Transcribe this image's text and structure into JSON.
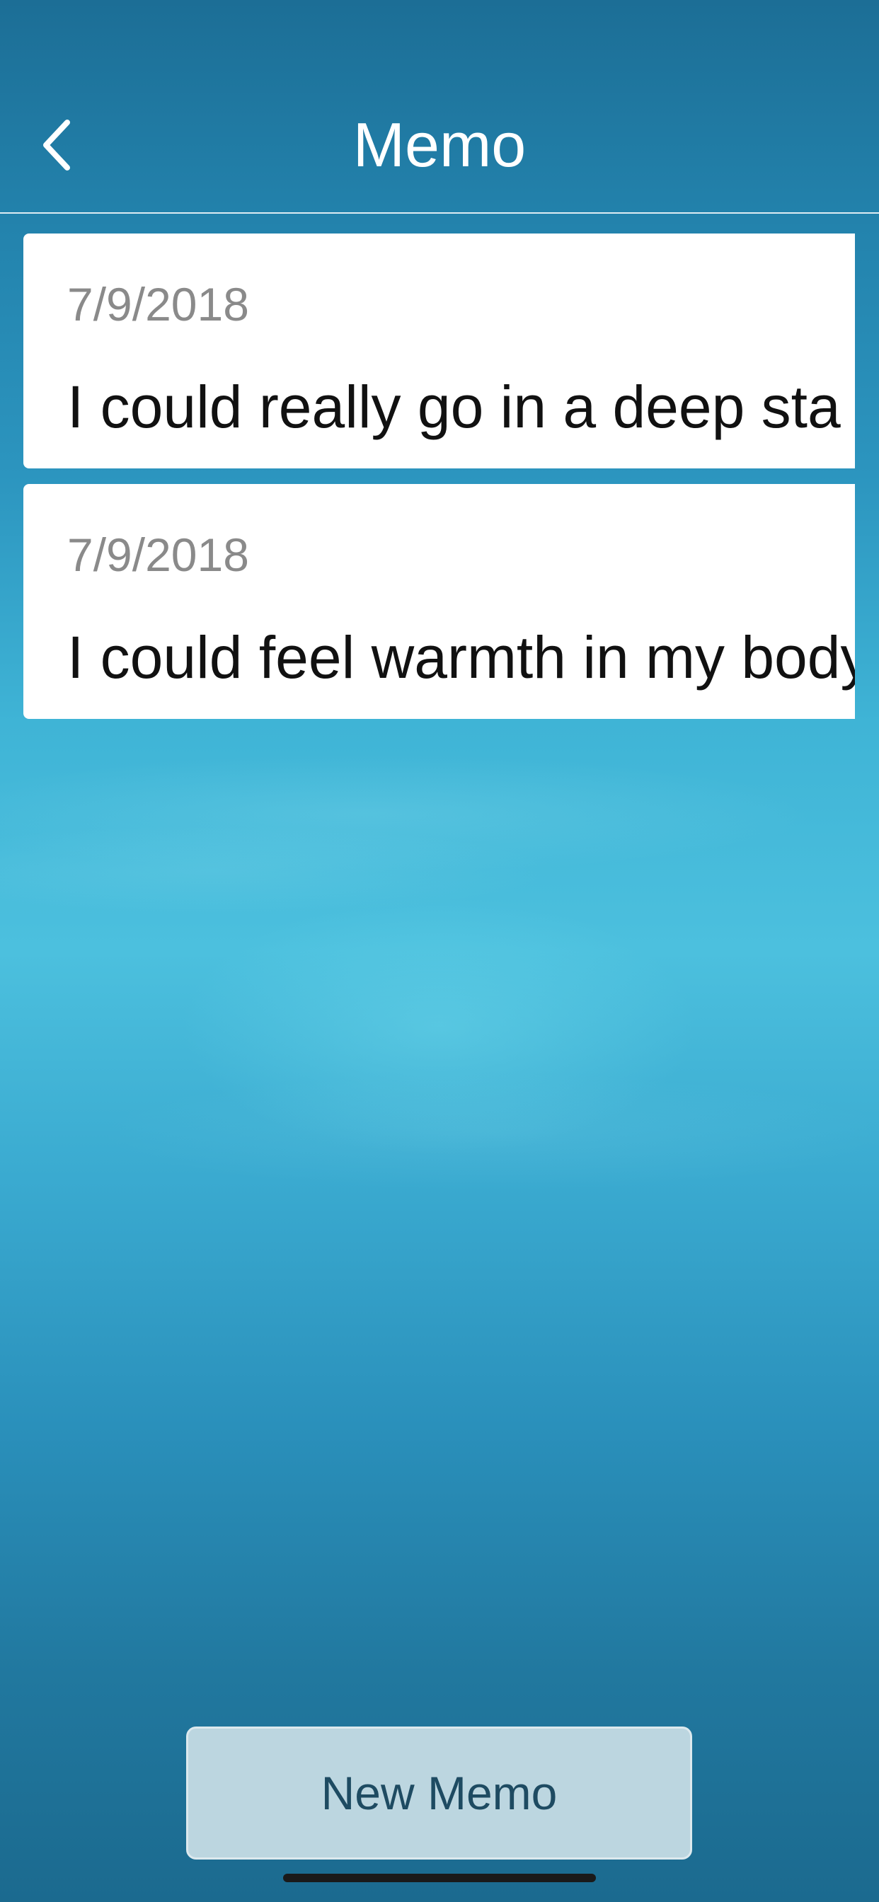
{
  "header": {
    "title": "Memo",
    "back_icon": "chevron-left-icon"
  },
  "memos": [
    {
      "date": "7/9/2018",
      "text": "I could really go in a deep sta"
    },
    {
      "date": "7/9/2018",
      "text": "I could feel warmth in my body"
    }
  ],
  "footer": {
    "new_memo_label": "New Memo"
  },
  "colors": {
    "background_top": "#1c6e96",
    "background_mid": "#4cc0de",
    "card": "#ffffff",
    "date_text": "#8a8a8a",
    "button_bg": "#bcd6e0",
    "button_text": "#1e4b62"
  }
}
